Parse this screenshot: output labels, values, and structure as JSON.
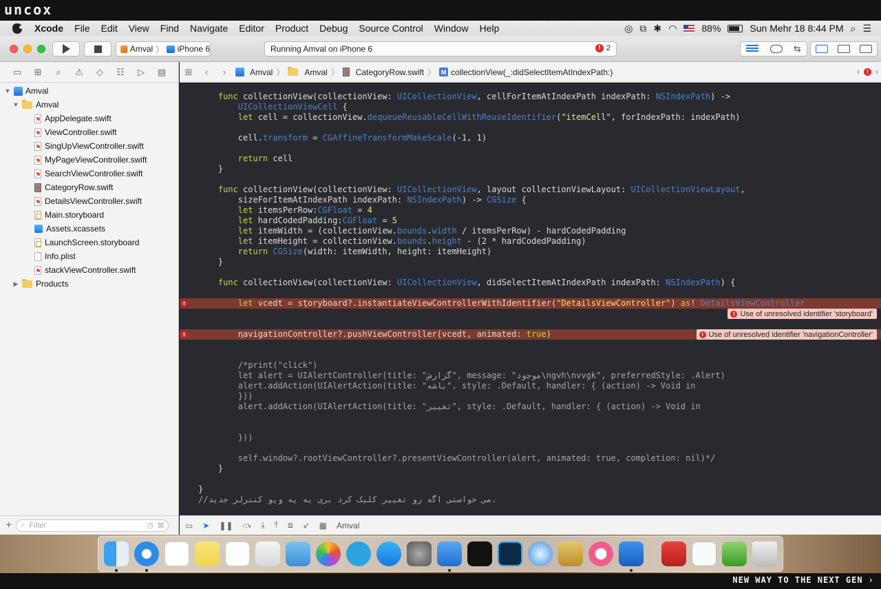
{
  "watermark": {
    "logo": "uncox",
    "footer": "NEW WAY TO THE NEXT GEN ›"
  },
  "menubar": {
    "app": "Xcode",
    "items": [
      "File",
      "Edit",
      "View",
      "Find",
      "Navigate",
      "Editor",
      "Product",
      "Debug",
      "Source Control",
      "Window",
      "Help"
    ],
    "battery": "88%",
    "clock": "Sun Mehr 18  8:44 PM"
  },
  "toolbar": {
    "scheme": "Amval",
    "device": "iPhone 6",
    "activity": "Running Amval on iPhone 6",
    "error_count": "2"
  },
  "navigator": {
    "project": "Amval",
    "group": "Amval",
    "files": [
      "AppDelegate.swift",
      "ViewController.swift",
      "SingUpViewController.swift",
      "MyPageViewController.swift",
      "SearchViewController.swift",
      "CategoryRow.swift",
      "DetailsViewController.swift",
      "Main.storyboard",
      "Assets.xcassets",
      "LaunchScreen.storyboard",
      "Info.plist",
      "stackViewController.swift"
    ],
    "products": "Products",
    "filter_placeholder": "Filter"
  },
  "jumpbar": {
    "crumbs": [
      "Amval",
      "Amval",
      "CategoryRow.swift",
      "collectionView(_:didSelectItemAtIndexPath:)"
    ]
  },
  "issues": [
    "Use of unresolved identifier 'storyboard'",
    "Use of unresolved identifier 'navigationController'"
  ],
  "debugbar": {
    "target": "Amval"
  },
  "colors": {
    "editor_bg": "#292a30",
    "error_line": "#7d3a2e",
    "keyword": "#c3d34f",
    "type": "#4c82c4",
    "accent": "#1f73e6"
  }
}
